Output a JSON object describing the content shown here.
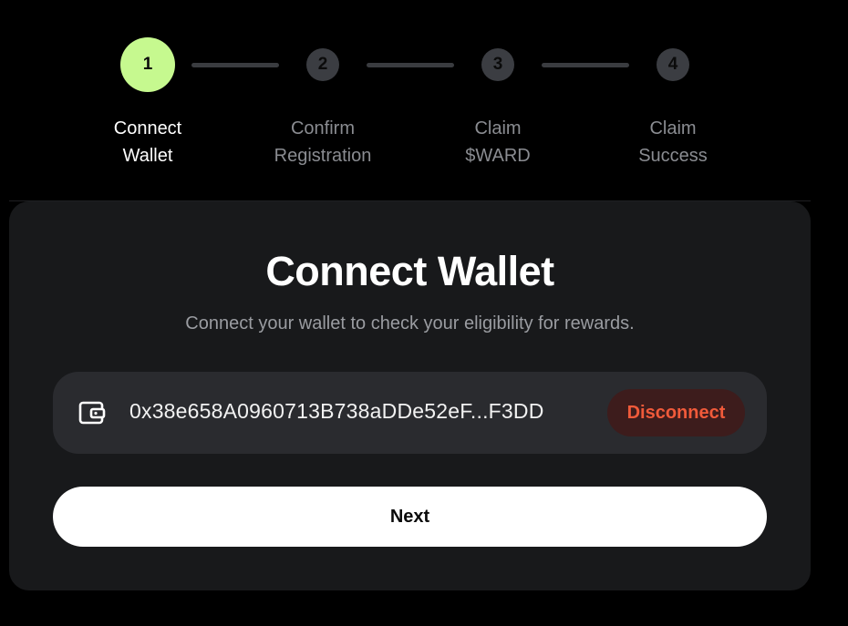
{
  "stepper": {
    "steps": [
      {
        "number": "1",
        "line1": "Connect",
        "line2": "Wallet",
        "state": "active"
      },
      {
        "number": "2",
        "line1": "Confirm",
        "line2": "Registration",
        "state": "inactive"
      },
      {
        "number": "3",
        "line1": "Claim",
        "line2": "$WARD",
        "state": "inactive"
      },
      {
        "number": "4",
        "line1": "Claim",
        "line2": "Success",
        "state": "inactive"
      }
    ]
  },
  "card": {
    "title": "Connect Wallet",
    "subtitle": "Connect your wallet to check your eligibility for rewards.",
    "wallet": {
      "icon": "wallet-icon",
      "address": "0x38e658A0960713B738aDDe52eF...F3DD",
      "disconnect_label": "Disconnect"
    },
    "next_label": "Next"
  },
  "colors": {
    "active_step": "#c6f98f",
    "inactive_step": "#3b3d42",
    "card_bg": "#18191b",
    "wallet_row_bg": "#2a2b2f",
    "disconnect_text": "#f05a3a",
    "disconnect_bg": "#3d1c1c"
  }
}
